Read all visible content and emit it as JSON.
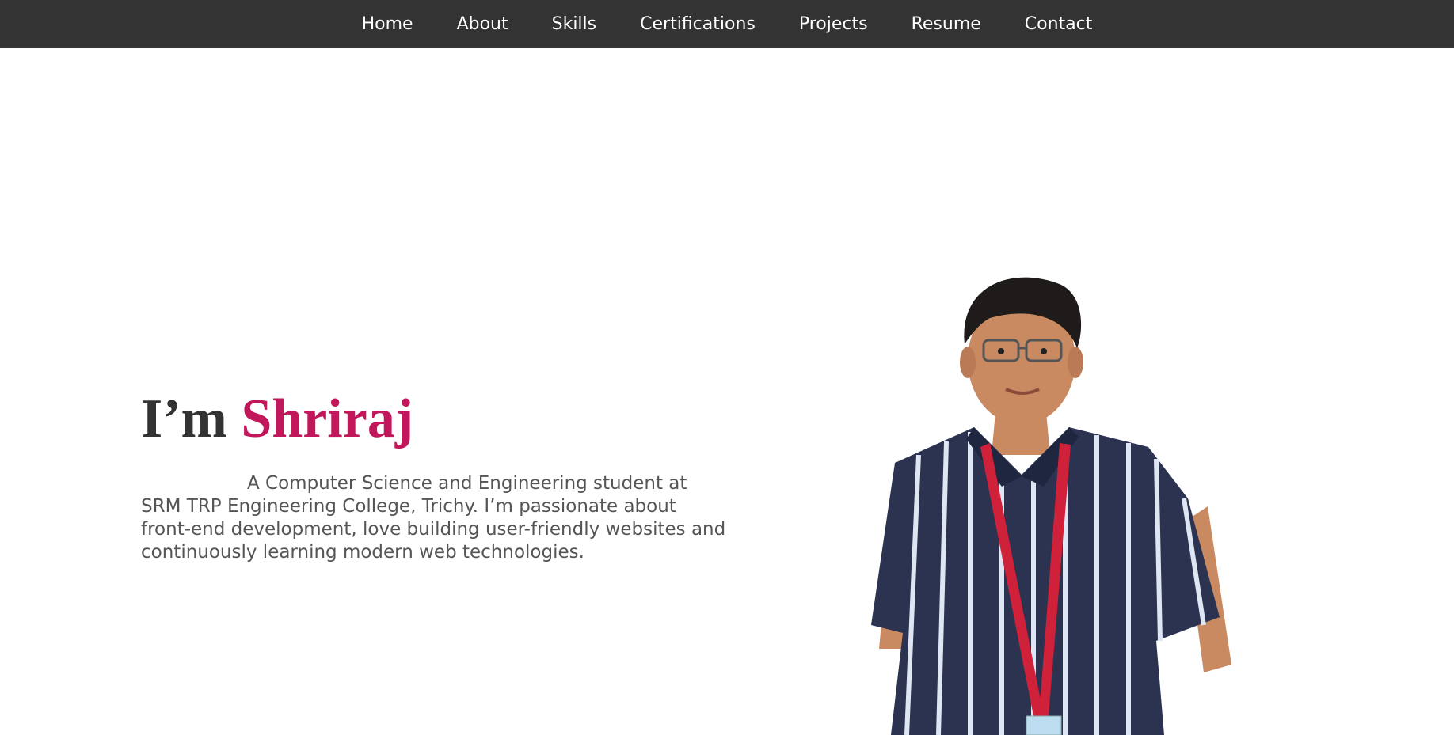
{
  "nav": {
    "items": [
      {
        "label": "Home"
      },
      {
        "label": "About"
      },
      {
        "label": "Skills"
      },
      {
        "label": "Certifications"
      },
      {
        "label": "Projects"
      },
      {
        "label": "Resume"
      },
      {
        "label": "Contact"
      }
    ]
  },
  "hero": {
    "greeting": "I’m ",
    "name": "Shriraj",
    "description": "A Computer Science and Engineering student at SRM TRP Engineering College, Trichy. I’m passionate about front-end development, love building user-friendly websites and continuously learning modern web technologies."
  },
  "colors": {
    "navbar_bg": "#333333",
    "accent": "#c2185b",
    "heading": "#333333",
    "body_text": "#555555"
  }
}
